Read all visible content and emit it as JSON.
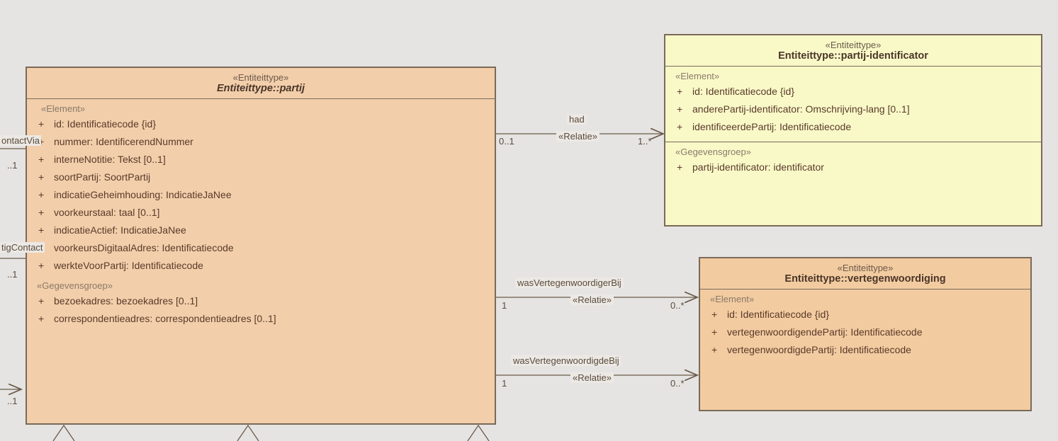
{
  "entities": {
    "partij": {
      "stereotype": "«Entiteittype»",
      "name": "Entiteittype::partij",
      "elementLabel": "«Element»",
      "elements": [
        "id: Identificatiecode {id}",
        "nummer: IdentificerendNummer",
        "interneNotitie: Tekst [0..1]",
        "soortPartij: SoortPartij",
        "indicatieGeheimhouding: IndicatieJaNee",
        "voorkeurstaal: taal [0..1]",
        "indicatieActief: IndicatieJaNee",
        "voorkeursDigitaalAdres: Identificatiecode",
        "werkteVoorPartij: Identificatiecode"
      ],
      "groupLabel": "«Gegevensgroep»",
      "groups": [
        "bezoekadres: bezoekadres [0..1]",
        "correspondentieadres: correspondentieadres [0..1]"
      ]
    },
    "identificator": {
      "stereotype": "«Entiteittype»",
      "name": "Entiteittype::partij-identificator",
      "elementLabel": "«Element»",
      "elements": [
        "id: Identificatiecode {id}",
        "anderePartij-identificator: Omschrijving-lang [0..1]",
        "identificeerdePartij: Identificatiecode"
      ],
      "groupLabel": "«Gegevensgroep»",
      "groups": [
        "partij-identificator: identificator"
      ]
    },
    "vertegenwoordiging": {
      "stereotype": "«Entiteittype»",
      "name": "Entiteittype::vertegenwoordiging",
      "elementLabel": "«Element»",
      "elements": [
        "id: Identificatiecode {id}",
        "vertegenwoordigendePartij: Identificatiecode",
        "vertegenwoordigdePartij: Identificatiecode"
      ]
    }
  },
  "relations": {
    "had": {
      "name": "had",
      "rel": "«Relatie»",
      "m1": "0..1",
      "m2": "1..*"
    },
    "wasVertegenwoordigerBij": {
      "name": "wasVertegenwoordigerBij",
      "rel": "«Relatie»",
      "m1": "1",
      "m2": "0..*"
    },
    "wasVertegenwoordigdeBij": {
      "name": "wasVertegenwoordigdeBij",
      "rel": "«Relatie»",
      "m1": "1",
      "m2": "0..*"
    }
  },
  "fragments": {
    "contactVia": {
      "label": "ontactVia",
      "mult": "..1"
    },
    "tigContact": {
      "label": "tigContact",
      "mult": "..1"
    },
    "leftMult": "..1"
  }
}
